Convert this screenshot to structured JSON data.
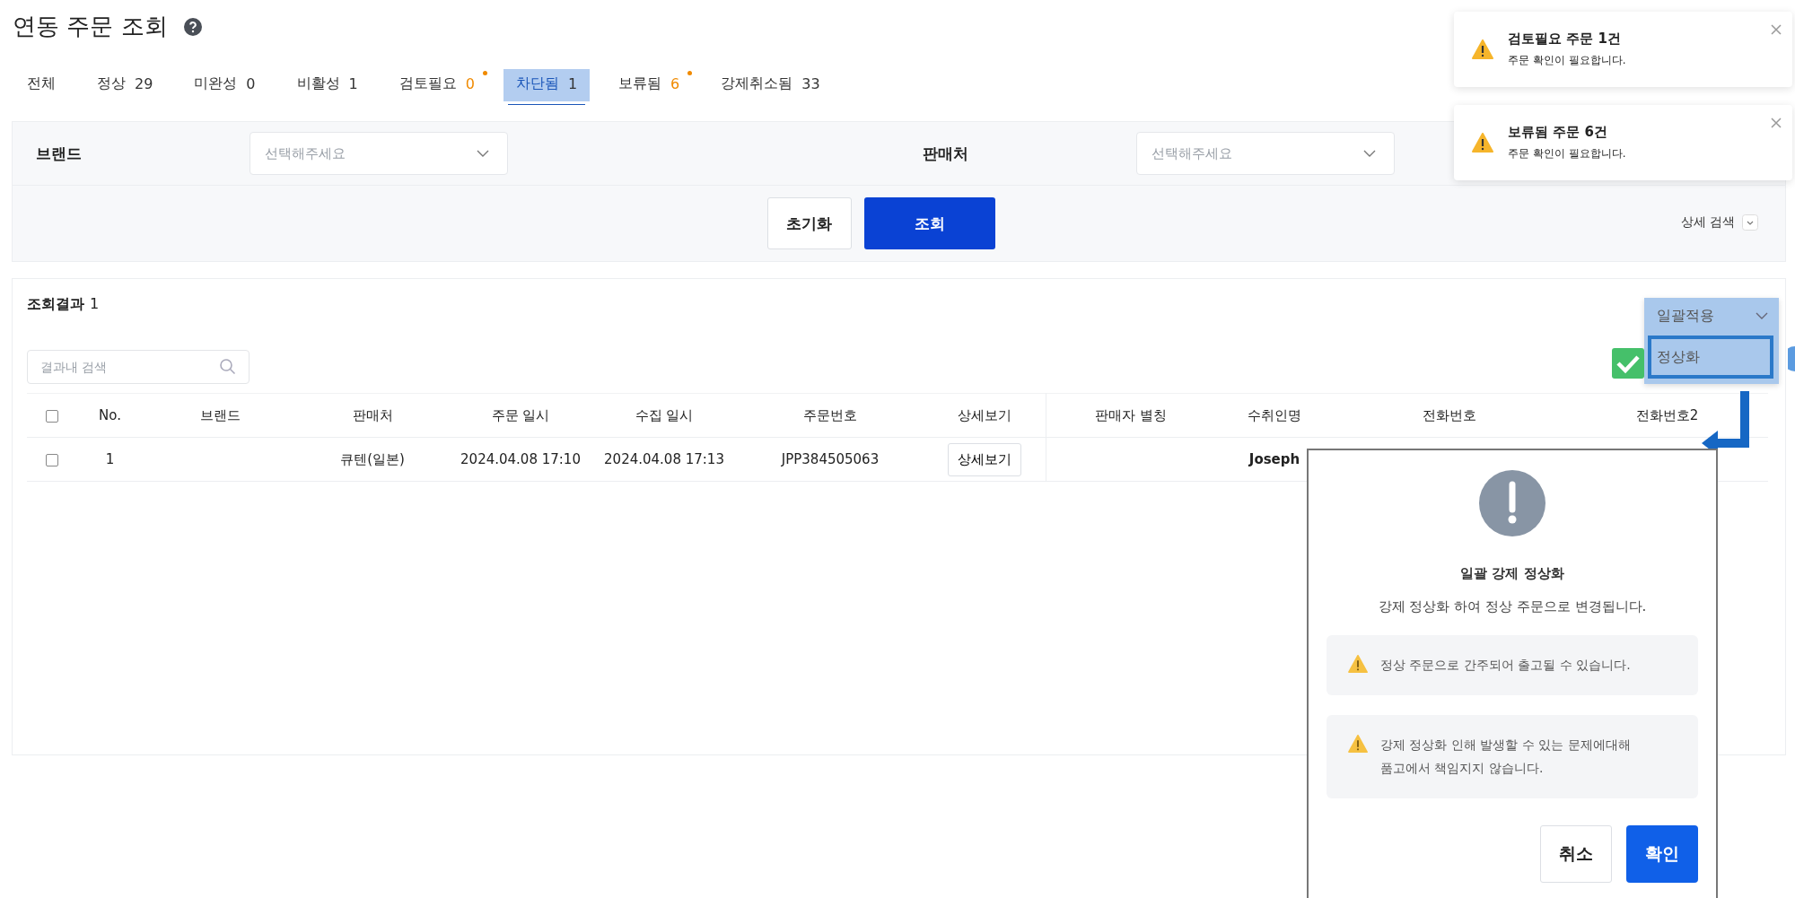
{
  "title": "연동 주문 조회",
  "tabs": [
    {
      "label": "전체",
      "selected": false
    },
    {
      "label": "정상",
      "count": "29",
      "alert": false,
      "selected": false
    },
    {
      "label": "미완성",
      "count": "0",
      "alert": false,
      "selected": false
    },
    {
      "label": "비활성",
      "count": "1",
      "alert": false,
      "selected": false
    },
    {
      "label": "검토필요",
      "count": "0",
      "alert": true,
      "selected": false
    },
    {
      "label": "차단됨",
      "count": "1",
      "alert": false,
      "selected": true
    },
    {
      "label": "보류됨",
      "count": "6",
      "alert": true,
      "selected": false
    },
    {
      "label": "강제취소됨",
      "count": "33",
      "alert": false,
      "selected": false
    }
  ],
  "filters": [
    {
      "label": "브랜드",
      "placeholder": "선택해주세요"
    },
    {
      "label": "판매처",
      "placeholder": "선택해주세요"
    }
  ],
  "filter_buttons": [
    {
      "label": "초기화",
      "kind": "secondary"
    },
    {
      "label": "조회",
      "kind": "primary"
    }
  ],
  "advanced_search": "상세 검색",
  "results": {
    "title": "조회결과",
    "count": "1",
    "search": {
      "placeholder": "결과내 검색"
    },
    "header_checked": false,
    "columns": [
      "No.",
      "브랜드",
      "판매처",
      "주문 일시",
      "수집 일시",
      "주문번호",
      "상세보기",
      "판매자 별칭",
      "수취인명",
      "전화번호",
      "전화번호2"
    ],
    "rows": [
      {
        "checked": false,
        "no": "1",
        "seller": "큐텐(일본)",
        "ordered_at": "2024.04.08 17:10",
        "collected_at": "2024.04.08 17:13",
        "order_no": "JPP384505063",
        "detail_button": "상세보기",
        "recipient": "Joseph"
      }
    ]
  },
  "bulk_action": {
    "label": "일괄적용",
    "options": [
      {
        "label": "정상화",
        "selected": true
      }
    ]
  },
  "toasts": [
    {
      "title": "검토필요 주문 1건",
      "message": "주문 확인이 필요합니다."
    },
    {
      "title": "보류됨 주문 6건",
      "message": "주문 확인이 필요합니다."
    }
  ],
  "dialog": {
    "title": "일괄 강제 정상화",
    "message": "강제 정상화 하여 정상 주문으로 변경됩니다.",
    "warnings": [
      "정상 주문으로 간주되어 출고될 수 있습니다.",
      "강제 정상화 인해 발생할 수 있는 문제에대해 품고에서 책임지지 않습니다."
    ],
    "buttons": [
      {
        "label": "취소",
        "kind": "secondary"
      },
      {
        "label": "확인",
        "kind": "primary"
      }
    ]
  }
}
